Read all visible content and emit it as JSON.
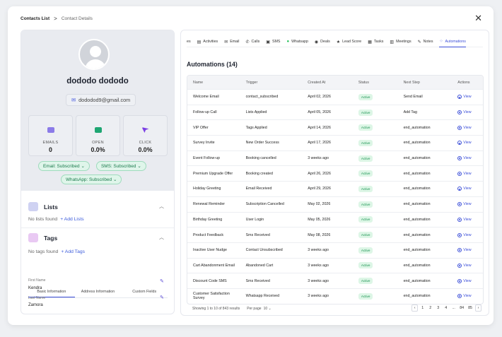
{
  "breadcrumb": {
    "root": "Contacts List",
    "separator": ">",
    "current": "Contact Details"
  },
  "close_glyph": "✕",
  "profile": {
    "name": "dododo dododo",
    "email": "dododod9@gmail.com",
    "stats": [
      {
        "label": "EMAILS",
        "value": "0",
        "icon": "envelope-icon",
        "color": "#8b7be8"
      },
      {
        "label": "OPEN",
        "value": "0.0%",
        "icon": "open-envelope-icon",
        "color": "#1ea672"
      },
      {
        "label": "CLICK",
        "value": "0.0%",
        "icon": "cursor-icon",
        "color": "#7b3fe4"
      }
    ],
    "subscriptions": {
      "email": "Email: Subscribed",
      "sms": "SMS: Subscribed",
      "whatsapp": "WhatsApp: Subscribed"
    }
  },
  "lists": {
    "title": "Lists",
    "empty": "No lists found",
    "add": "+ Add Lists"
  },
  "tags": {
    "title": "Tags",
    "empty": "No tags found",
    "add": "+ Add Tags"
  },
  "info_tabs": [
    "Basic Information",
    "Address Information",
    "Custom Fields"
  ],
  "fields": [
    {
      "label": "First Name",
      "value": "Kendra"
    },
    {
      "label": "Last Name",
      "value": "Zamora"
    }
  ],
  "tabs": [
    {
      "label": "es",
      "icon": ""
    },
    {
      "label": "Activities",
      "icon": "▤"
    },
    {
      "label": "Email",
      "icon": "✉"
    },
    {
      "label": "Calls",
      "icon": "✆"
    },
    {
      "label": "SMS",
      "icon": "▣"
    },
    {
      "label": "Whatsapp",
      "icon": "●"
    },
    {
      "label": "Deals",
      "icon": "◉"
    },
    {
      "label": "Lead Score",
      "icon": "★"
    },
    {
      "label": "Tasks",
      "icon": "▦"
    },
    {
      "label": "Meetings",
      "icon": "▥"
    },
    {
      "label": "Notes",
      "icon": "✎"
    },
    {
      "label": "Automations",
      "icon": "⁘"
    }
  ],
  "automations": {
    "title": "Automations (14)",
    "columns": [
      "Name",
      "Trigger",
      "Created At",
      "Status",
      "Next Step",
      "Actions"
    ],
    "rows": [
      [
        "Welcome Email",
        "contact_subscribed",
        "April 02, 2026",
        "Active",
        "Send Email",
        "View"
      ],
      [
        "Follow-up Call",
        "Lists Applied",
        "April 05, 2026",
        "Active",
        "Add Tag",
        "View"
      ],
      [
        "VIP Offer",
        "Tags Applied",
        "April 14, 2026",
        "Active",
        "end_automation",
        "View"
      ],
      [
        "Survey Invite",
        "New Order Success",
        "April 17, 2026",
        "Active",
        "end_automation",
        "View"
      ],
      [
        "Event Follow-up",
        "Booking cancelled",
        "3 weeks ago",
        "Active",
        "end_automation",
        "View"
      ],
      [
        "Premium Upgrade Offer",
        "Booking created",
        "April 26, 2026",
        "Active",
        "end_automation",
        "View"
      ],
      [
        "Holiday Greeting",
        "Email Received",
        "April 29, 2026",
        "Active",
        "end_automation",
        "View"
      ],
      [
        "Renewal Reminder",
        "Subscription Cancelled",
        "May 02, 2026",
        "Active",
        "end_automation",
        "View"
      ],
      [
        "Birthday Greeting",
        "User Login",
        "May 05, 2026",
        "Active",
        "end_automation",
        "View"
      ],
      [
        "Product Feedback",
        "Sms Received",
        "May 08, 2026",
        "Active",
        "end_automation",
        "View"
      ],
      [
        "Inactive User Nudge",
        "Contact Unsubscribed",
        "3 weeks ago",
        "Active",
        "end_automation",
        "View"
      ],
      [
        "Cart Abandonment Email",
        "Abandoned Cart",
        "3 weeks ago",
        "Active",
        "end_automation",
        "View"
      ],
      [
        "Discount Code SMS",
        "Sms Received",
        "3 weeks ago",
        "Active",
        "end_automation",
        "View"
      ],
      [
        "Customer Satisfaction Survey",
        "Whatsapp Received",
        "3 weeks ago",
        "Active",
        "end_automation",
        "View"
      ]
    ]
  },
  "pagination": {
    "summary": "Showing 1 to 10 of 843 results",
    "per_page_label": "Per page",
    "per_page_value": "10",
    "pages": [
      "‹",
      "1",
      "2",
      "3",
      "4",
      "...",
      "84",
      "85",
      "›"
    ]
  }
}
